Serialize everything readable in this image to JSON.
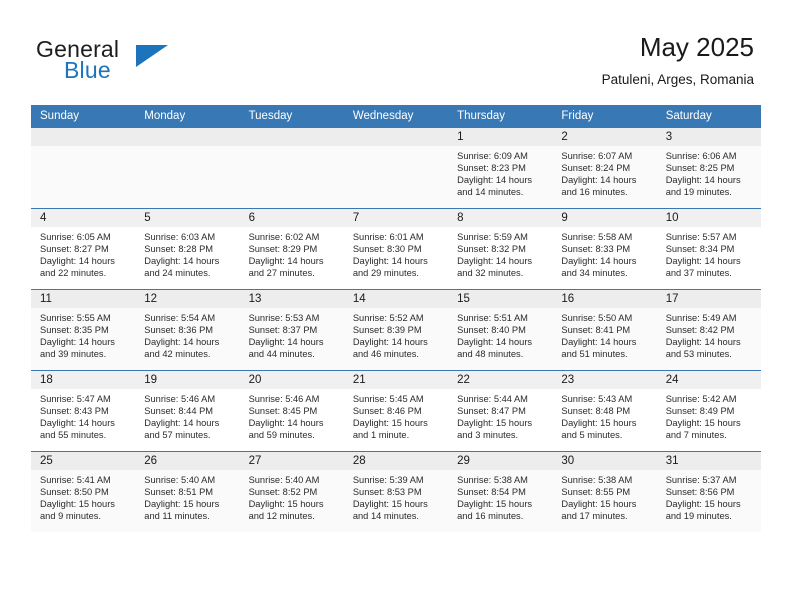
{
  "brand": {
    "general": "General",
    "blue": "Blue",
    "triangle_color": "#1c74bc"
  },
  "header": {
    "title": "May 2025",
    "subtitle": "Patuleni, Arges, Romania"
  },
  "theme": {
    "header_bg": "#3878b4",
    "header_text": "#ffffff",
    "daynum_bg": "#f0f0f0",
    "row_alt_bg": "#fafafa"
  },
  "weekday_headers": [
    "Sunday",
    "Monday",
    "Tuesday",
    "Wednesday",
    "Thursday",
    "Friday",
    "Saturday"
  ],
  "weeks": [
    [
      {
        "day": "",
        "sunrise": "",
        "sunset": "",
        "daylight1": "",
        "daylight2": "",
        "empty": true
      },
      {
        "day": "",
        "sunrise": "",
        "sunset": "",
        "daylight1": "",
        "daylight2": "",
        "empty": true
      },
      {
        "day": "",
        "sunrise": "",
        "sunset": "",
        "daylight1": "",
        "daylight2": "",
        "empty": true
      },
      {
        "day": "",
        "sunrise": "",
        "sunset": "",
        "daylight1": "",
        "daylight2": "",
        "empty": true
      },
      {
        "day": "1",
        "sunrise": "Sunrise: 6:09 AM",
        "sunset": "Sunset: 8:23 PM",
        "daylight1": "Daylight: 14 hours",
        "daylight2": "and 14 minutes."
      },
      {
        "day": "2",
        "sunrise": "Sunrise: 6:07 AM",
        "sunset": "Sunset: 8:24 PM",
        "daylight1": "Daylight: 14 hours",
        "daylight2": "and 16 minutes."
      },
      {
        "day": "3",
        "sunrise": "Sunrise: 6:06 AM",
        "sunset": "Sunset: 8:25 PM",
        "daylight1": "Daylight: 14 hours",
        "daylight2": "and 19 minutes."
      }
    ],
    [
      {
        "day": "4",
        "sunrise": "Sunrise: 6:05 AM",
        "sunset": "Sunset: 8:27 PM",
        "daylight1": "Daylight: 14 hours",
        "daylight2": "and 22 minutes."
      },
      {
        "day": "5",
        "sunrise": "Sunrise: 6:03 AM",
        "sunset": "Sunset: 8:28 PM",
        "daylight1": "Daylight: 14 hours",
        "daylight2": "and 24 minutes."
      },
      {
        "day": "6",
        "sunrise": "Sunrise: 6:02 AM",
        "sunset": "Sunset: 8:29 PM",
        "daylight1": "Daylight: 14 hours",
        "daylight2": "and 27 minutes."
      },
      {
        "day": "7",
        "sunrise": "Sunrise: 6:01 AM",
        "sunset": "Sunset: 8:30 PM",
        "daylight1": "Daylight: 14 hours",
        "daylight2": "and 29 minutes."
      },
      {
        "day": "8",
        "sunrise": "Sunrise: 5:59 AM",
        "sunset": "Sunset: 8:32 PM",
        "daylight1": "Daylight: 14 hours",
        "daylight2": "and 32 minutes."
      },
      {
        "day": "9",
        "sunrise": "Sunrise: 5:58 AM",
        "sunset": "Sunset: 8:33 PM",
        "daylight1": "Daylight: 14 hours",
        "daylight2": "and 34 minutes."
      },
      {
        "day": "10",
        "sunrise": "Sunrise: 5:57 AM",
        "sunset": "Sunset: 8:34 PM",
        "daylight1": "Daylight: 14 hours",
        "daylight2": "and 37 minutes."
      }
    ],
    [
      {
        "day": "11",
        "sunrise": "Sunrise: 5:55 AM",
        "sunset": "Sunset: 8:35 PM",
        "daylight1": "Daylight: 14 hours",
        "daylight2": "and 39 minutes."
      },
      {
        "day": "12",
        "sunrise": "Sunrise: 5:54 AM",
        "sunset": "Sunset: 8:36 PM",
        "daylight1": "Daylight: 14 hours",
        "daylight2": "and 42 minutes."
      },
      {
        "day": "13",
        "sunrise": "Sunrise: 5:53 AM",
        "sunset": "Sunset: 8:37 PM",
        "daylight1": "Daylight: 14 hours",
        "daylight2": "and 44 minutes."
      },
      {
        "day": "14",
        "sunrise": "Sunrise: 5:52 AM",
        "sunset": "Sunset: 8:39 PM",
        "daylight1": "Daylight: 14 hours",
        "daylight2": "and 46 minutes."
      },
      {
        "day": "15",
        "sunrise": "Sunrise: 5:51 AM",
        "sunset": "Sunset: 8:40 PM",
        "daylight1": "Daylight: 14 hours",
        "daylight2": "and 48 minutes."
      },
      {
        "day": "16",
        "sunrise": "Sunrise: 5:50 AM",
        "sunset": "Sunset: 8:41 PM",
        "daylight1": "Daylight: 14 hours",
        "daylight2": "and 51 minutes."
      },
      {
        "day": "17",
        "sunrise": "Sunrise: 5:49 AM",
        "sunset": "Sunset: 8:42 PM",
        "daylight1": "Daylight: 14 hours",
        "daylight2": "and 53 minutes."
      }
    ],
    [
      {
        "day": "18",
        "sunrise": "Sunrise: 5:47 AM",
        "sunset": "Sunset: 8:43 PM",
        "daylight1": "Daylight: 14 hours",
        "daylight2": "and 55 minutes."
      },
      {
        "day": "19",
        "sunrise": "Sunrise: 5:46 AM",
        "sunset": "Sunset: 8:44 PM",
        "daylight1": "Daylight: 14 hours",
        "daylight2": "and 57 minutes."
      },
      {
        "day": "20",
        "sunrise": "Sunrise: 5:46 AM",
        "sunset": "Sunset: 8:45 PM",
        "daylight1": "Daylight: 14 hours",
        "daylight2": "and 59 minutes."
      },
      {
        "day": "21",
        "sunrise": "Sunrise: 5:45 AM",
        "sunset": "Sunset: 8:46 PM",
        "daylight1": "Daylight: 15 hours",
        "daylight2": "and 1 minute."
      },
      {
        "day": "22",
        "sunrise": "Sunrise: 5:44 AM",
        "sunset": "Sunset: 8:47 PM",
        "daylight1": "Daylight: 15 hours",
        "daylight2": "and 3 minutes."
      },
      {
        "day": "23",
        "sunrise": "Sunrise: 5:43 AM",
        "sunset": "Sunset: 8:48 PM",
        "daylight1": "Daylight: 15 hours",
        "daylight2": "and 5 minutes."
      },
      {
        "day": "24",
        "sunrise": "Sunrise: 5:42 AM",
        "sunset": "Sunset: 8:49 PM",
        "daylight1": "Daylight: 15 hours",
        "daylight2": "and 7 minutes."
      }
    ],
    [
      {
        "day": "25",
        "sunrise": "Sunrise: 5:41 AM",
        "sunset": "Sunset: 8:50 PM",
        "daylight1": "Daylight: 15 hours",
        "daylight2": "and 9 minutes."
      },
      {
        "day": "26",
        "sunrise": "Sunrise: 5:40 AM",
        "sunset": "Sunset: 8:51 PM",
        "daylight1": "Daylight: 15 hours",
        "daylight2": "and 11 minutes."
      },
      {
        "day": "27",
        "sunrise": "Sunrise: 5:40 AM",
        "sunset": "Sunset: 8:52 PM",
        "daylight1": "Daylight: 15 hours",
        "daylight2": "and 12 minutes."
      },
      {
        "day": "28",
        "sunrise": "Sunrise: 5:39 AM",
        "sunset": "Sunset: 8:53 PM",
        "daylight1": "Daylight: 15 hours",
        "daylight2": "and 14 minutes."
      },
      {
        "day": "29",
        "sunrise": "Sunrise: 5:38 AM",
        "sunset": "Sunset: 8:54 PM",
        "daylight1": "Daylight: 15 hours",
        "daylight2": "and 16 minutes."
      },
      {
        "day": "30",
        "sunrise": "Sunrise: 5:38 AM",
        "sunset": "Sunset: 8:55 PM",
        "daylight1": "Daylight: 15 hours",
        "daylight2": "and 17 minutes."
      },
      {
        "day": "31",
        "sunrise": "Sunrise: 5:37 AM",
        "sunset": "Sunset: 8:56 PM",
        "daylight1": "Daylight: 15 hours",
        "daylight2": "and 19 minutes."
      }
    ]
  ]
}
